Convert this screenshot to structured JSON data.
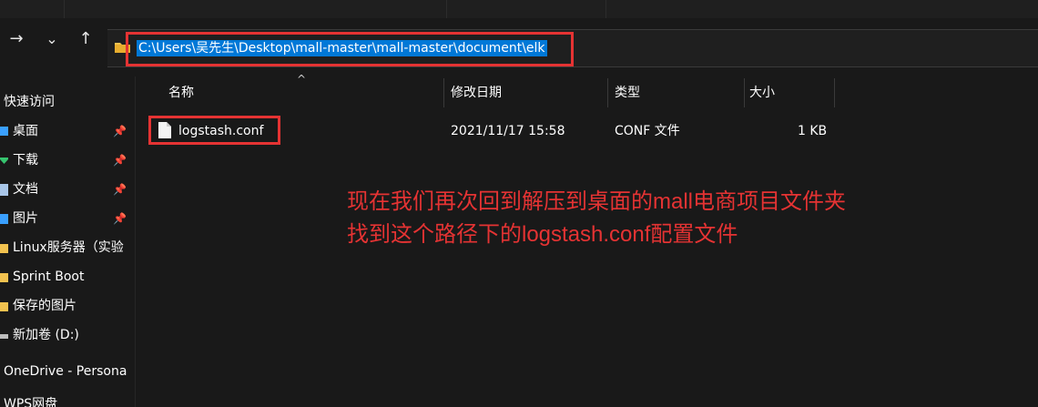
{
  "address_bar": {
    "path": "C:\\Users\\吴先生\\Desktop\\mall-master\\mall-master\\document\\elk"
  },
  "nav": {
    "forward_glyph": "→",
    "dropdown_glyph": "⌄",
    "up_glyph": "↑"
  },
  "sidebar": {
    "quick_access": "快速访问",
    "items": [
      {
        "label": "桌面",
        "icon": "desktop-icon",
        "pinned": true
      },
      {
        "label": "下载",
        "icon": "download-icon",
        "pinned": true
      },
      {
        "label": "文档",
        "icon": "document-icon",
        "pinned": true
      },
      {
        "label": "图片",
        "icon": "picture-icon",
        "pinned": true
      },
      {
        "label": "Linux服务器（实验",
        "icon": "folder-icon",
        "pinned": false
      },
      {
        "label": "Sprint Boot",
        "icon": "folder-icon",
        "pinned": false
      },
      {
        "label": "保存的图片",
        "icon": "folder-icon",
        "pinned": false
      },
      {
        "label": "新加卷 (D:)",
        "icon": "drive-icon",
        "pinned": false
      }
    ],
    "onedrive": "OneDrive - Persona",
    "wps": "WPS网盘",
    "pin_glyph": "📌"
  },
  "columns": {
    "name": "名称",
    "modified": "修改日期",
    "type": "类型",
    "size": "大小",
    "sort_glyph": "^"
  },
  "files": [
    {
      "name": "logstash.conf",
      "modified": "2021/11/17 15:58",
      "type": "CONF 文件",
      "size": "1 KB"
    }
  ],
  "annotation": {
    "line1": "现在我们再次回到解压到桌面的mall电商项目文件夹",
    "line2": "找到这个路径下的logstash.conf配置文件"
  },
  "colors": {
    "background": "#191919",
    "selection": "#0078d7",
    "highlight_red": "#e53333",
    "folder_yellow": "#f2c24f"
  }
}
